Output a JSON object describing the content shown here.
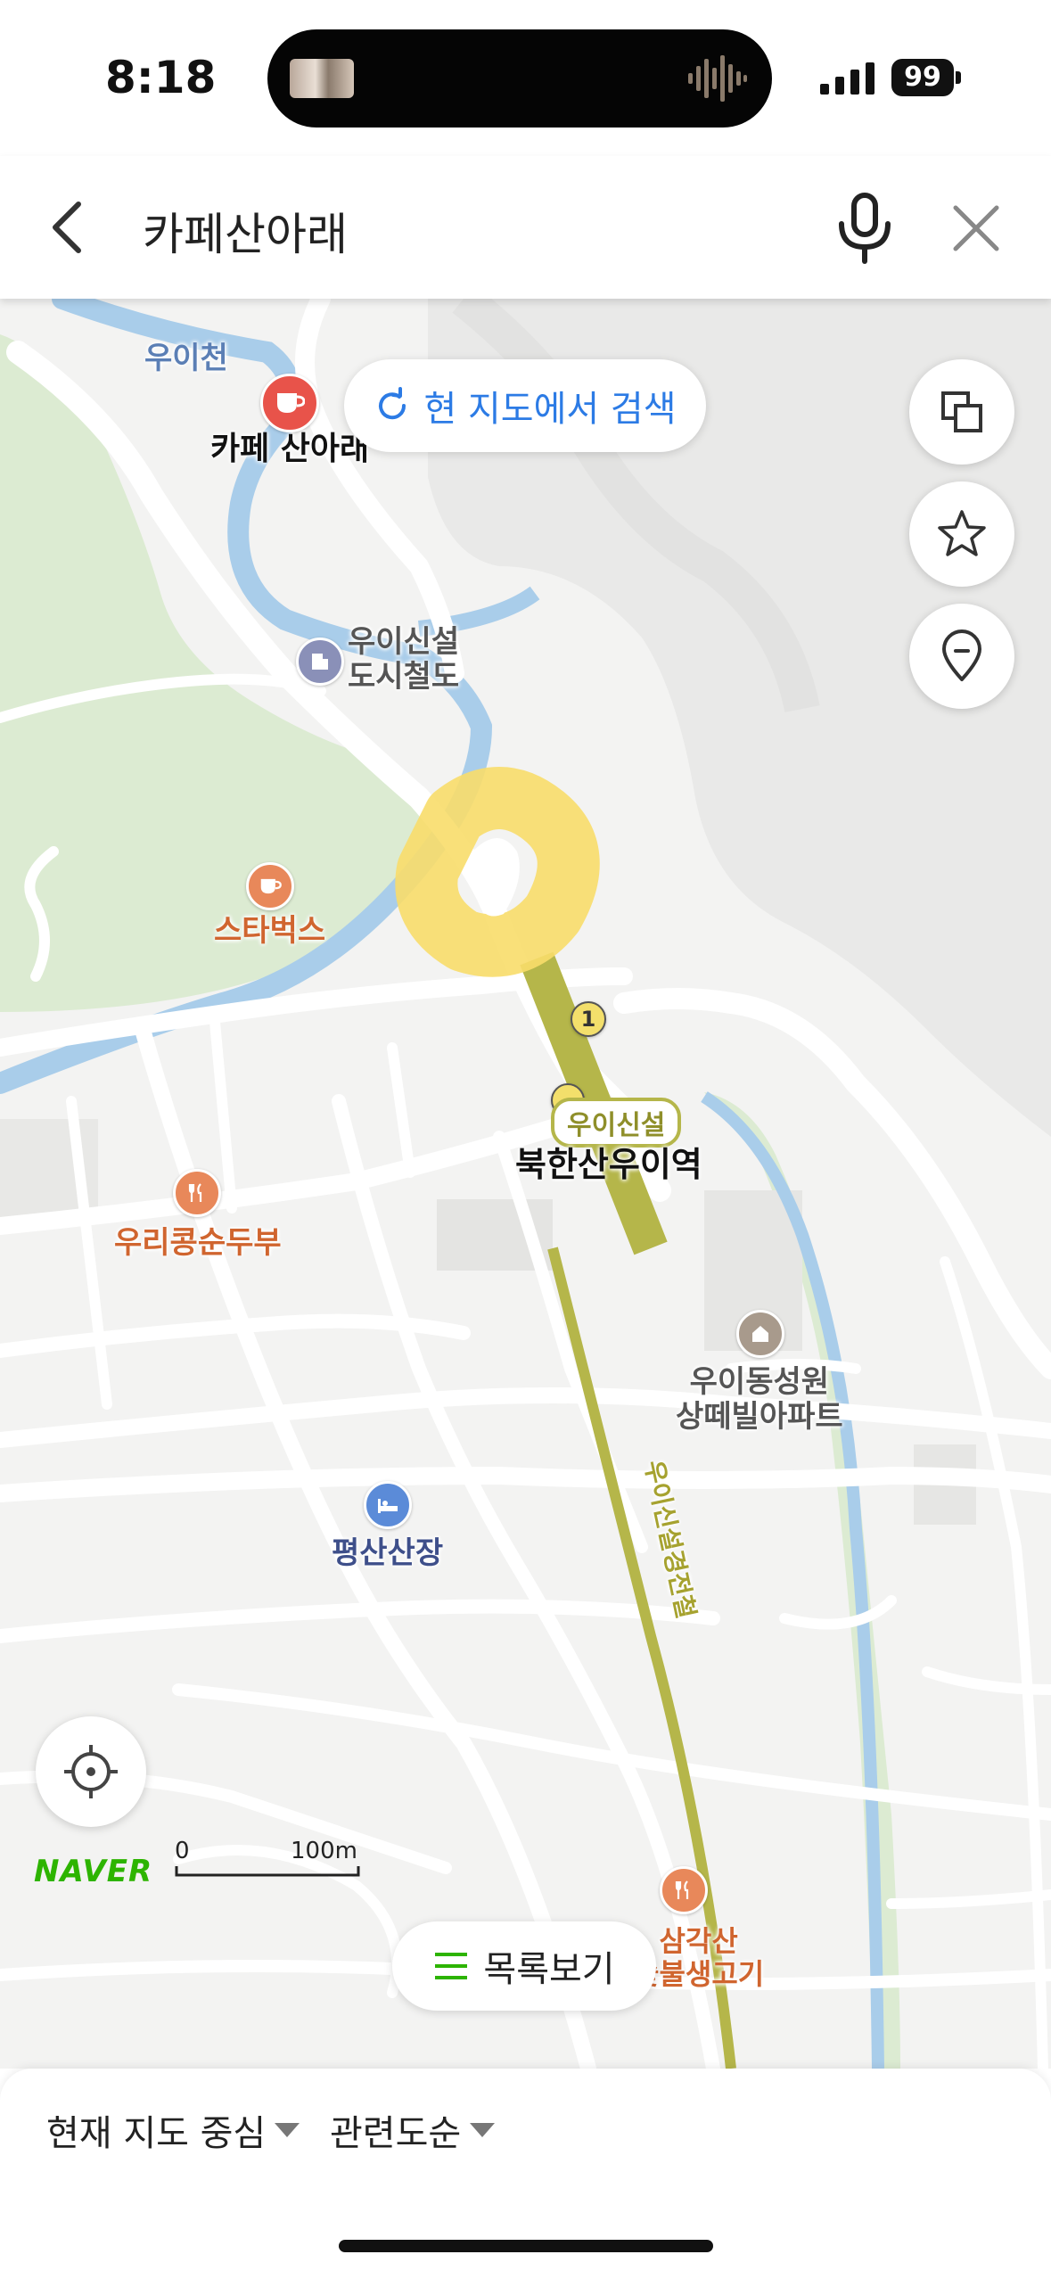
{
  "status_bar": {
    "time": "8:18",
    "battery": "99"
  },
  "search": {
    "query": "카페산아래"
  },
  "map": {
    "research_button": "현 지도에서 검색",
    "list_button": "목록보기",
    "naver_logo": "NAVER",
    "scale": {
      "start": "0",
      "end": "100m"
    },
    "labels": {
      "stream_ui": "우이천",
      "cafe_sanarae": "카페 산아래",
      "ui_sinseol_line": "우이신설\n도시철도",
      "starbucks": "스타벅스",
      "station_badge": "우이신설",
      "station_exit": "1",
      "station": "북한산우이역",
      "tofu": "우리콩순두부",
      "apartment": "우이동성원\n상떼빌아파트",
      "line_name": "우이신설경전철",
      "pyeongsan": "평산산장",
      "samgaksan": "삼각산\n숯불생고기"
    }
  },
  "filters": {
    "center": "현재 지도 중심",
    "sort": "관련도순"
  },
  "colors": {
    "accent_blue": "#2c7be5",
    "naver_green": "#2db400",
    "cafe_red": "#e8534a",
    "cafe_orange": "#e8885a",
    "stream_blue": "#a9cdea",
    "park_green": "#dcebd2",
    "line_olive": "#b5b64a",
    "highlight_yellow": "#f8dd6a"
  }
}
